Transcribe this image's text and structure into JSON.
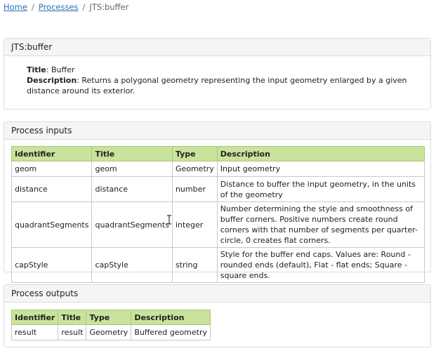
{
  "breadcrumb": {
    "home": "Home",
    "processes": "Processes",
    "current": "JTS:buffer",
    "separator": "/"
  },
  "info": {
    "header": "JTS:buffer",
    "title_label": "Title",
    "title_value": "Buffer",
    "description_label": "Description",
    "description_value": "Returns a polygonal geometry representing the input geometry enlarged by a given distance around its exterior."
  },
  "inputs": {
    "header": "Process inputs",
    "columns": [
      "Identifier",
      "Title",
      "Type",
      "Description"
    ],
    "rows": [
      [
        "geom",
        "geom",
        "Geometry",
        "Input geometry"
      ],
      [
        "distance",
        "distance",
        "number",
        "Distance to buffer the input geometry, in the units of the geometry"
      ],
      [
        "quadrantSegments",
        "quadrantSegments",
        "integer",
        "Number determining the style and smoothness of buffer corners. Positive numbers create round corners with that number of segments per quarter-circle, 0 creates flat corners."
      ],
      [
        "capStyle",
        "capStyle",
        "string",
        "Style for the buffer end caps. Values are: Round - rounded ends (default), Flat - flat ends; Square - square ends."
      ]
    ]
  },
  "outputs": {
    "header": "Process outputs",
    "columns": [
      "Identifier",
      "Title",
      "Type",
      "Description"
    ],
    "rows": [
      [
        "result",
        "result",
        "Geometry",
        "Buffered geometry"
      ]
    ]
  },
  "colors": {
    "table_header": "#c9e39c",
    "link": "#2a6fb5"
  }
}
